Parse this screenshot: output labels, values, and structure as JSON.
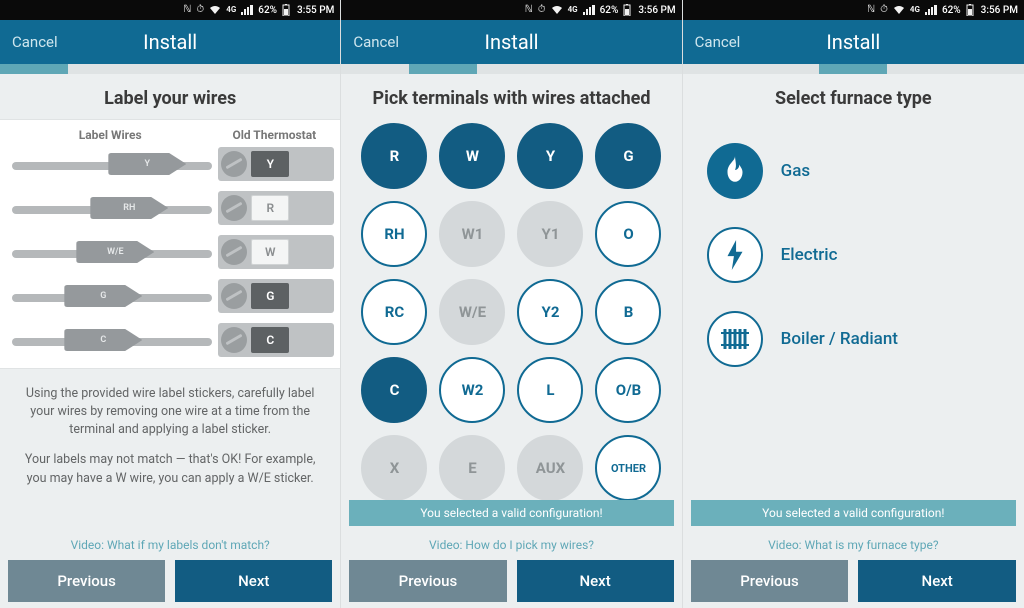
{
  "status_icons": [
    "nfc",
    "alarm",
    "wifi",
    "lte",
    "signal"
  ],
  "battery_pct": "62%",
  "screens": [
    {
      "time": "3:55 PM",
      "cancel": "Cancel",
      "title": "Install",
      "heading": "Label your wires",
      "wires_header_left": "Label Wires",
      "wires_header_right": "Old Thermostat",
      "wires": [
        {
          "tag": "Y",
          "term": "Y",
          "term_style": "dark"
        },
        {
          "tag": "RH",
          "term": "R",
          "term_style": "light"
        },
        {
          "tag": "W/E",
          "term": "W",
          "term_style": "light"
        },
        {
          "tag": "G",
          "term": "G",
          "term_style": "dark"
        },
        {
          "tag": "C",
          "term": "C",
          "term_style": "dark"
        }
      ],
      "instr1": "Using the provided wire label stickers, carefully label your wires by removing one wire at a time from the terminal and applying a label sticker.",
      "instr2": "Your labels may not match — that's OK! For example, you may have a W wire, you can apply a W/E sticker.",
      "video": "Video: What if my labels don't match?",
      "prev": "Previous",
      "next": "Next"
    },
    {
      "time": "3:56 PM",
      "cancel": "Cancel",
      "title": "Install",
      "heading": "Pick terminals with wires attached",
      "terminals": [
        {
          "t": "R",
          "s": "sel"
        },
        {
          "t": "W",
          "s": "sel"
        },
        {
          "t": "Y",
          "s": "sel"
        },
        {
          "t": "G",
          "s": "sel"
        },
        {
          "t": "RH",
          "s": ""
        },
        {
          "t": "W1",
          "s": "dis"
        },
        {
          "t": "Y1",
          "s": "dis"
        },
        {
          "t": "O",
          "s": ""
        },
        {
          "t": "RC",
          "s": ""
        },
        {
          "t": "W/E",
          "s": "dis"
        },
        {
          "t": "Y2",
          "s": ""
        },
        {
          "t": "B",
          "s": ""
        },
        {
          "t": "C",
          "s": "sel"
        },
        {
          "t": "W2",
          "s": ""
        },
        {
          "t": "L",
          "s": ""
        },
        {
          "t": "O/B",
          "s": ""
        },
        {
          "t": "X",
          "s": "dis"
        },
        {
          "t": "E",
          "s": "dis"
        },
        {
          "t": "AUX",
          "s": "dis"
        },
        {
          "t": "OTHER",
          "s": "",
          "other": true
        }
      ],
      "banner": "You selected a valid configuration!",
      "video": "Video: How do I pick my wires?",
      "prev": "Previous",
      "next": "Next"
    },
    {
      "time": "3:56 PM",
      "cancel": "Cancel",
      "title": "Install",
      "heading": "Select furnace type",
      "furnace_types": [
        {
          "id": "gas",
          "label": "Gas",
          "selected": true
        },
        {
          "id": "electric",
          "label": "Electric",
          "selected": false
        },
        {
          "id": "boiler",
          "label": "Boiler / Radiant",
          "selected": false
        }
      ],
      "banner": "You selected a valid configuration!",
      "video": "Video: What is my furnace type?",
      "prev": "Previous",
      "next": "Next"
    }
  ]
}
